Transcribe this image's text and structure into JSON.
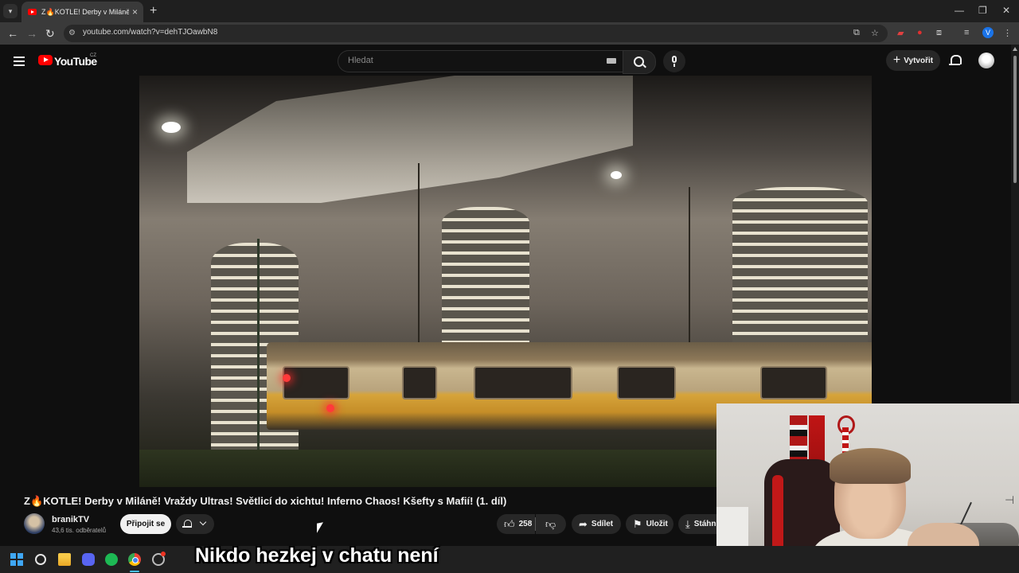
{
  "browser": {
    "tab_title": "Z🔥KOTLE! Derby v Miláně! Vraždy Ultras!",
    "url": "youtube.com/watch?v=dehTJOawbN8",
    "profile_initial": "V",
    "icons": [
      "tab-search-icon",
      "youtube-favicon",
      "close-icon",
      "plus-icon",
      "minimize-icon",
      "restore-icon",
      "window-close-icon",
      "back-icon",
      "forward-icon",
      "reload-icon",
      "site-info-icon",
      "install-icon",
      "star-icon",
      "extension-icon",
      "puzzle-icon",
      "media-icon"
    ]
  },
  "youtube": {
    "logo_text": "YouTube",
    "country_code": "CZ",
    "search_placeholder": "Hledat",
    "create_label": "Vytvořit"
  },
  "video": {
    "title": "Z🔥KOTLE! Derby v Miláně! Vraždy Ultras! Světlicí do xichtu! Inferno Chaos! Kšefty s Mafií! (1. díl)",
    "channel_name": "branikTV",
    "subscribers": "43,6 tis. odběratelů",
    "subscribe_label": "Připojit se",
    "like_count": "258",
    "share_label": "Sdílet",
    "save_label": "Uložit",
    "download_label": "Stáhn"
  },
  "overlay": {
    "caption": "Nikdo hezkej v chatu není"
  },
  "colors": {
    "background": "#0f0f0f",
    "youtube_red": "#ff0000",
    "chrome_frame": "#1f1f1f",
    "pill": "#272727"
  }
}
